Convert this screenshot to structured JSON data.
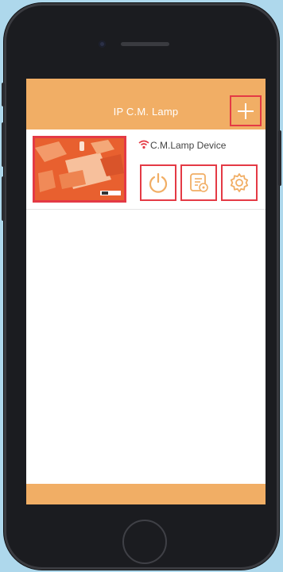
{
  "app": {
    "title": "IP C.M. Lamp"
  },
  "device": {
    "name": "C.M.Lamp Device",
    "status_icon": "wifi-icon",
    "actions": [
      {
        "name": "power",
        "icon": "power-icon"
      },
      {
        "name": "schedule",
        "icon": "schedule-list-icon"
      },
      {
        "name": "settings",
        "icon": "gear-icon"
      }
    ]
  },
  "colors": {
    "accent": "#f1ae65",
    "highlight": "#e43a45",
    "icon": "#f1ae65"
  }
}
